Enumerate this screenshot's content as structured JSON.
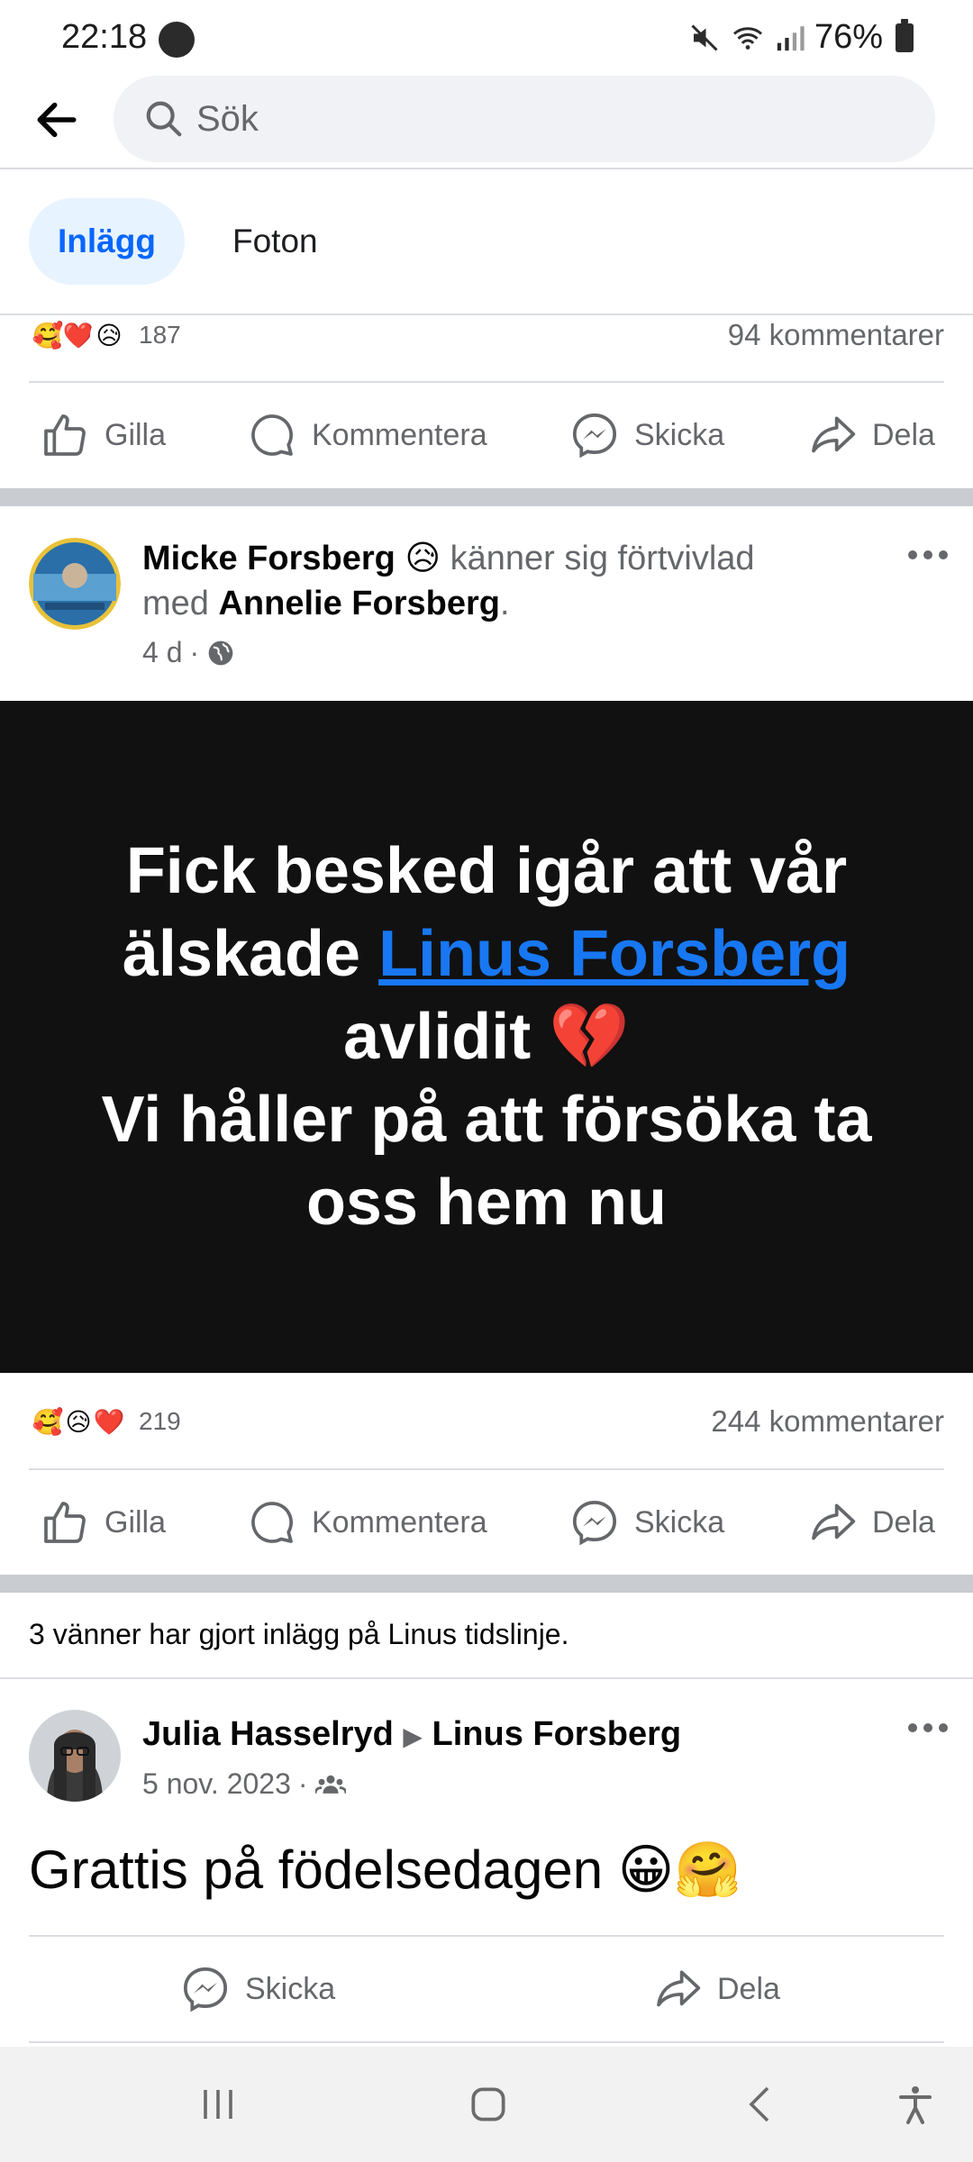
{
  "status_bar": {
    "time": "22:18",
    "battery": "76%"
  },
  "search": {
    "placeholder": "Sök"
  },
  "tabs": [
    {
      "label": "Inlägg"
    },
    {
      "label": "Foton"
    }
  ],
  "post1": {
    "reactions": [
      "🥰",
      "❤️",
      "😥"
    ],
    "reaction_count": "187",
    "comment_count": "94 kommentarer"
  },
  "actions": {
    "like": "Gilla",
    "comment": "Kommentera",
    "send": "Skicka",
    "share": "Dela"
  },
  "post2": {
    "author": "Micke Forsberg",
    "feeling_emoji": "😥",
    "feeling": "känner sig förtvivlad",
    "with_prefix": "med",
    "with_name": "Annelie Forsberg",
    "time": "4 d",
    "card_line1": "Fick besked igår att vår",
    "card_line2_prefix": "älskade",
    "card_link": "Linus Forsberg",
    "card_line3": "avlidit",
    "card_heart": "💔",
    "card_line4": "Vi håller på att försöka ta",
    "card_line5": "oss hem nu",
    "reactions": [
      "🥰",
      "😥",
      "❤️"
    ],
    "reaction_count": "219",
    "comment_count": "244 kommentarer"
  },
  "friends_note": "3 vänner har gjort inlägg på Linus tidslinje.",
  "post3": {
    "author": "Julia Hasselryd",
    "target": "Linus Forsberg",
    "date": "5 nov. 2023",
    "text": "Grattis på födelsedagen 😀🤗",
    "send": "Skicka",
    "share": "Dela"
  },
  "colors": {
    "accent": "#0866ff",
    "tab_bg": "#e7f3ff",
    "card_bg": "#111111",
    "link": "#1877f2"
  }
}
